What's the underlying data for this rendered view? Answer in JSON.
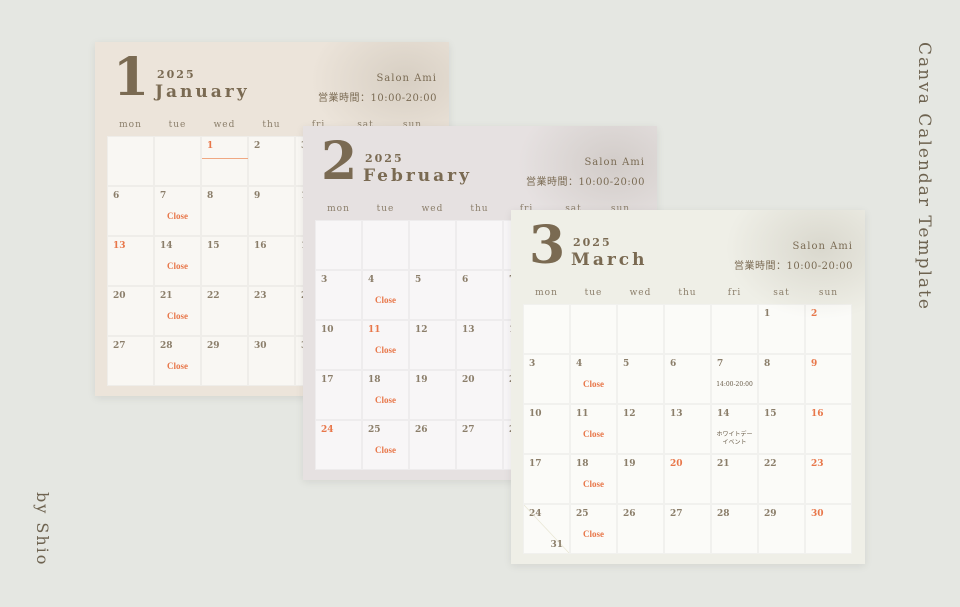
{
  "side_title": "Canva Calendar Template",
  "author": "by Shio",
  "weekdays": [
    "mon",
    "tue",
    "wed",
    "thu",
    "fri",
    "sat",
    "sun"
  ],
  "salon": "Salon Ami",
  "hours": "営業時間：10:00-20:00",
  "close_label": "Close",
  "colors": {
    "accent": "#e8774a",
    "text": "#7a6a52",
    "background": "#e5e7e2"
  },
  "months": [
    {
      "num": "1",
      "year": "2025",
      "name": "January",
      "bg": "#ece4da",
      "cell": "#f9f7f3",
      "offset": 2,
      "days": 31,
      "red": [
        1,
        13
      ],
      "close": [
        7,
        14,
        21,
        28
      ],
      "notes": {},
      "bar": {
        "day": 1,
        "label": "お正月休み"
      }
    },
    {
      "num": "2",
      "year": "2025",
      "name": "February",
      "bg": "#e6e1e1",
      "cell": "#f8f6f7",
      "offset": 5,
      "days": 28,
      "red": [
        11,
        24
      ],
      "close": [
        4,
        11,
        18,
        25
      ],
      "notes": {}
    },
    {
      "num": "3",
      "year": "2025",
      "name": "March",
      "bg": "#efefe7",
      "cell": "#fbfbf8",
      "offset": 5,
      "days": 30,
      "red": [
        2,
        9,
        16,
        20,
        23,
        30
      ],
      "close": [
        4,
        11,
        18,
        25
      ],
      "notes": {
        "7": "14:00-20:00",
        "14": "ホワイトデー\nイベント"
      },
      "split": {
        "day": 24,
        "second": "31"
      }
    }
  ]
}
